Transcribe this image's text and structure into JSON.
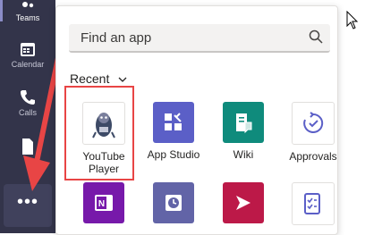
{
  "rail": {
    "items": [
      {
        "label": "Teams",
        "icon": "teams-icon"
      },
      {
        "label": "Calendar",
        "icon": "calendar-icon"
      },
      {
        "label": "Calls",
        "icon": "calls-icon"
      },
      {
        "label": "",
        "icon": "files-icon"
      }
    ],
    "more_label": "•••"
  },
  "flyout": {
    "search": {
      "placeholder": "Find an app",
      "value": ""
    },
    "section_label": "Recent",
    "apps_row1": [
      {
        "label": "YouTube\nPlayer",
        "icon": "youtube-player-icon",
        "color": "#ffffff"
      },
      {
        "label": "App Studio",
        "icon": "app-studio-icon",
        "color": "#5b5fc7"
      },
      {
        "label": "Wiki",
        "icon": "wiki-icon",
        "color": "#0f8b7c"
      },
      {
        "label": "Approvals",
        "icon": "approvals-icon",
        "color": "#ffffff"
      }
    ],
    "apps_row2": [
      {
        "label": "OneNote",
        "icon": "onenote-icon",
        "color": "#7719aa"
      },
      {
        "label": "Shifts",
        "icon": "shifts-icon",
        "color": "#6264a7"
      },
      {
        "label": "Stream",
        "icon": "stream-icon",
        "color": "#bc1948"
      },
      {
        "label": "Tasks",
        "icon": "tasks-icon",
        "color": "#ffffff"
      }
    ]
  },
  "annotation": {
    "highlight_color": "#e84545"
  }
}
